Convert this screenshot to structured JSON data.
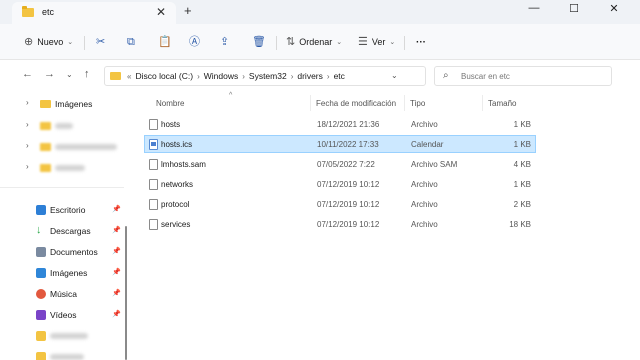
{
  "window": {
    "tab_title": "etc",
    "tab_close": "✕",
    "new_tab": "+",
    "minimize": "—",
    "maximize": "☐",
    "close": "✕"
  },
  "toolbar": {
    "new_label": "Nuevo",
    "sort_label": "Ordenar",
    "view_label": "Ver",
    "more_label": "···"
  },
  "address": {
    "crumbs": [
      "Disco local (C:)",
      "Windows",
      "System32",
      "drivers",
      "etc"
    ],
    "search_placeholder": "Buscar en etc"
  },
  "sidebar": {
    "top_items": [
      {
        "label": "Imágenes"
      }
    ],
    "quick_access": [
      {
        "label": "Escritorio",
        "icon": "desktop-icon",
        "color": "#2d7fd6"
      },
      {
        "label": "Descargas",
        "icon": "download-icon",
        "color": "#2aa84a"
      },
      {
        "label": "Documentos",
        "icon": "document-icon",
        "color": "#7a8aa0"
      },
      {
        "label": "Imágenes",
        "icon": "pictures-icon",
        "color": "#2f86d8"
      },
      {
        "label": "Música",
        "icon": "music-icon",
        "color": "#e2583e"
      },
      {
        "label": "Vídeos",
        "icon": "video-icon",
        "color": "#7a44c8"
      }
    ]
  },
  "columns": {
    "name": "Nombre",
    "date": "Fecha de modificación",
    "type": "Tipo",
    "size": "Tamaño"
  },
  "files": [
    {
      "name": "hosts",
      "date": "18/12/2021 21:36",
      "type": "Archivo",
      "size": "1 KB",
      "selected": false
    },
    {
      "name": "hosts.ics",
      "date": "10/11/2022 17:33",
      "type": "Calendar",
      "size": "1 KB",
      "selected": true
    },
    {
      "name": "lmhosts.sam",
      "date": "07/05/2022 7:22",
      "type": "Archivo SAM",
      "size": "4 KB",
      "selected": false
    },
    {
      "name": "networks",
      "date": "07/12/2019 10:12",
      "type": "Archivo",
      "size": "1 KB",
      "selected": false
    },
    {
      "name": "protocol",
      "date": "07/12/2019 10:12",
      "type": "Archivo",
      "size": "2 KB",
      "selected": false
    },
    {
      "name": "services",
      "date": "07/12/2019 10:12",
      "type": "Archivo",
      "size": "18 KB",
      "selected": false
    }
  ]
}
